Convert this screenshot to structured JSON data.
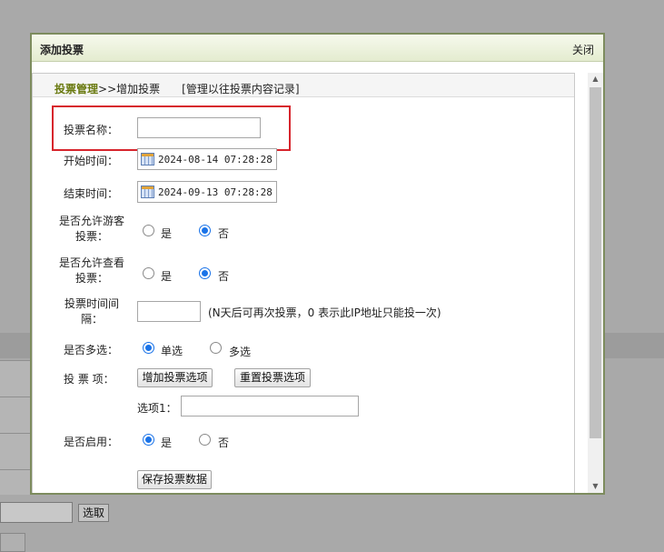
{
  "background": {
    "select_button_label": "选取"
  },
  "dialog": {
    "title": "添加投票",
    "close_label": "关闭"
  },
  "breadcrumb": {
    "manage_link": "投票管理",
    "separator": ">>",
    "current": "增加投票",
    "records_link": "[管理以往投票内容记录]"
  },
  "form": {
    "vote_name_label": "投票名称：",
    "vote_name_value": "",
    "start_time_label": "开始时间：",
    "start_time_value": "2024-08-14 07:28:28",
    "end_time_label": "结束时间：",
    "end_time_value": "2024-09-13 07:28:28",
    "guest_vote_label_1": "是否允许游客",
    "guest_vote_label_2": "投票：",
    "allow_view_label_1": "是否允许查看",
    "allow_view_label_2": "投票：",
    "yes_label": "是",
    "no_label": "否",
    "interval_label_1": "投票时间间",
    "interval_label_2": "隔：",
    "interval_value": "",
    "interval_hint": "(N天后可再次投票，0 表示此IP地址只能投一次)",
    "multi_label": "是否多选：",
    "single_option": "单选",
    "multi_option": "多选",
    "items_label": "投 票 项：",
    "add_option_button": "增加投票选项",
    "reset_option_button": "重置投票选项",
    "option1_label": "选项1：",
    "option1_value": "",
    "enabled_label": "是否启用：",
    "save_button": "保存投票数据"
  },
  "state": {
    "guest_vote": "否",
    "allow_view": "否",
    "multi": "单选",
    "enabled": "是"
  },
  "colors": {
    "dialog_border": "#7d8c5e",
    "header_bg": "#e4ecd0",
    "link_color": "#6a7a10",
    "highlight_border": "#d7242c",
    "radio_selected": "#1a73e8"
  }
}
